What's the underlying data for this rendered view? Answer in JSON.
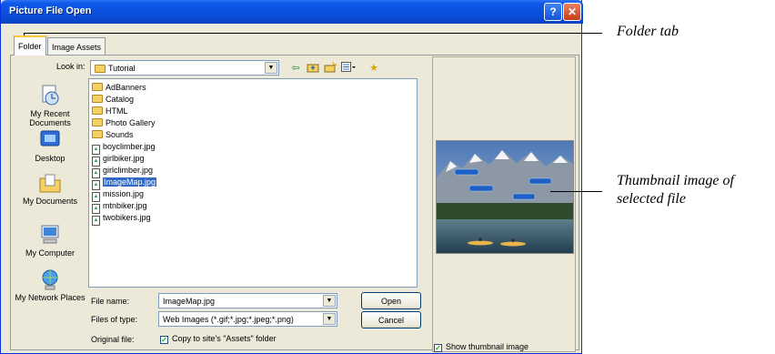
{
  "window": {
    "title": "Picture File Open",
    "help_glyph": "?",
    "close_glyph": "✕"
  },
  "tabs": [
    {
      "label": "Folder"
    },
    {
      "label": "Image Assets"
    }
  ],
  "look_in": {
    "label": "Look in:",
    "value": "Tutorial"
  },
  "places": [
    {
      "label": "My Recent Documents",
      "icon": "recent-documents-icon"
    },
    {
      "label": "Desktop",
      "icon": "desktop-icon"
    },
    {
      "label": "My Documents",
      "icon": "my-documents-icon"
    },
    {
      "label": "My Computer",
      "icon": "my-computer-icon"
    },
    {
      "label": "My Network Places",
      "icon": "network-places-icon"
    }
  ],
  "files": [
    {
      "name": "AdBanners",
      "type": "folder"
    },
    {
      "name": "Catalog",
      "type": "folder"
    },
    {
      "name": "HTML",
      "type": "folder"
    },
    {
      "name": "Photo Gallery",
      "type": "folder"
    },
    {
      "name": "Sounds",
      "type": "folder"
    },
    {
      "name": "boyclimber.jpg",
      "type": "image"
    },
    {
      "name": "girlbiker.jpg",
      "type": "image"
    },
    {
      "name": "girlclimber.jpg",
      "type": "image"
    },
    {
      "name": "ImageMap.jpg",
      "type": "image",
      "selected": true
    },
    {
      "name": "mission.jpg",
      "type": "image"
    },
    {
      "name": "mtnbiker.jpg",
      "type": "image"
    },
    {
      "name": "twobikers.jpg",
      "type": "image"
    }
  ],
  "file_name": {
    "label": "File name:",
    "value": "ImageMap.jpg"
  },
  "files_of_type": {
    "label": "Files of type:",
    "value": "Web Images (*.gif;*.jpg;*.jpeg;*.png)"
  },
  "original_file": {
    "label": "Original file:",
    "checkbox_label": "Copy to site's \"Assets\" folder",
    "checked": true
  },
  "buttons": {
    "open": "Open",
    "cancel": "Cancel"
  },
  "show_thumbnail": {
    "label": "Show thumbnail image",
    "checked": true
  },
  "callouts": {
    "folder_tab": "Folder tab",
    "thumbnail_line1": "Thumbnail image of",
    "thumbnail_line2": "selected file"
  },
  "colors": {
    "titlebar": "#0a4fdc",
    "selection": "#316ac5",
    "dialog_bg": "#ece9d8"
  }
}
